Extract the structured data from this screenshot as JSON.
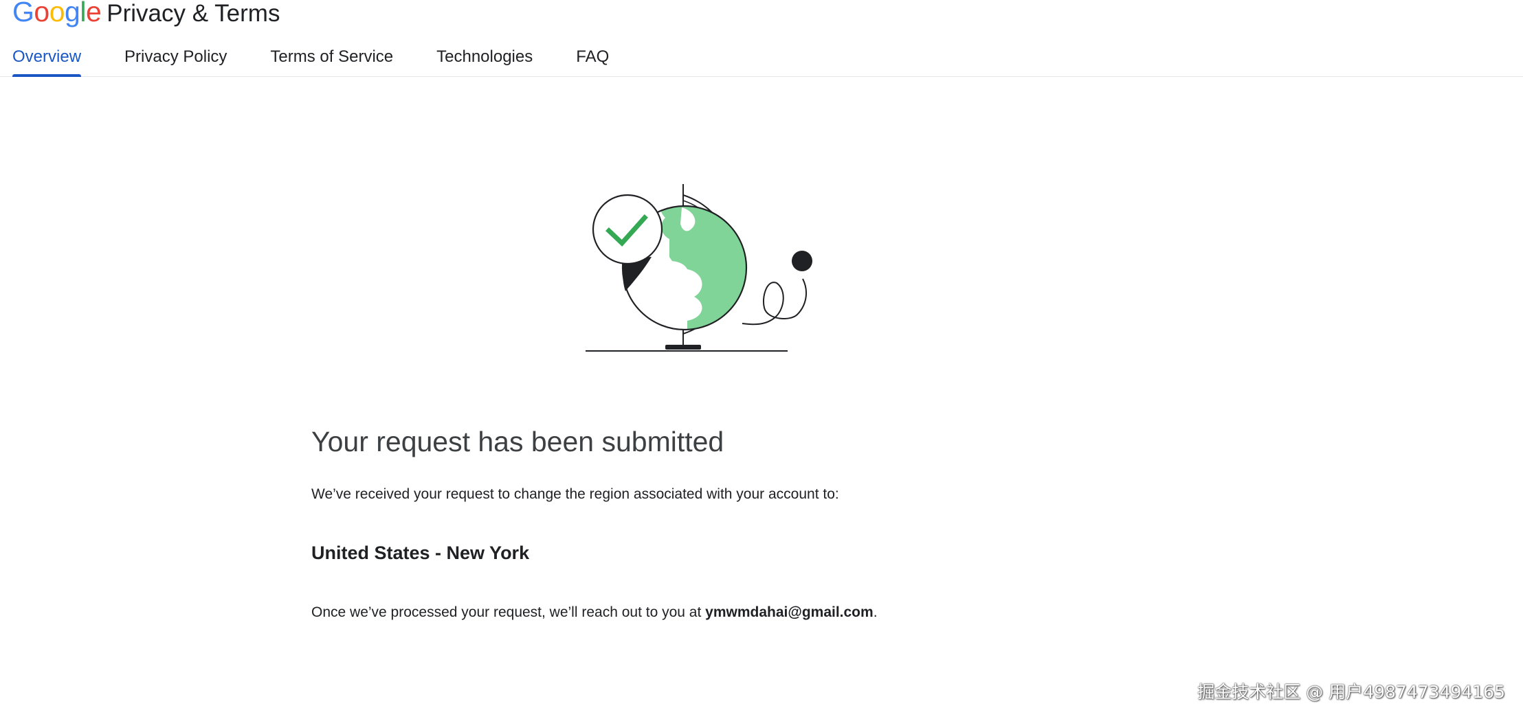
{
  "header": {
    "logo": {
      "letters": [
        "G",
        "o",
        "o",
        "g",
        "l",
        "e"
      ],
      "colors": [
        "#4285F4",
        "#EA4335",
        "#FBBC05",
        "#4285F4",
        "#34A853",
        "#EA4335"
      ]
    },
    "product_name": "Privacy & Terms",
    "tabs": [
      {
        "label": "Overview",
        "active": true
      },
      {
        "label": "Privacy Policy",
        "active": false
      },
      {
        "label": "Terms of Service",
        "active": false
      },
      {
        "label": "Technologies",
        "active": false
      },
      {
        "label": "FAQ",
        "active": false
      }
    ],
    "accent_color": "#1a57c4"
  },
  "illustration": {
    "icon": "globe-with-checkmark-pin-icon",
    "colors": {
      "land": "#81d498",
      "check": "#34a853",
      "line": "#202124"
    }
  },
  "main": {
    "title": "Your request has been submitted",
    "description": "We’ve received your request to change the region associated with your account to:",
    "region": "United States - New York",
    "followup_prefix": "Once we’ve processed your request, we’ll reach out to you at ",
    "email": "ymwmdahai@gmail.com",
    "followup_suffix": "."
  },
  "watermark": "掘金技术社区 @ 用户4987473494165"
}
